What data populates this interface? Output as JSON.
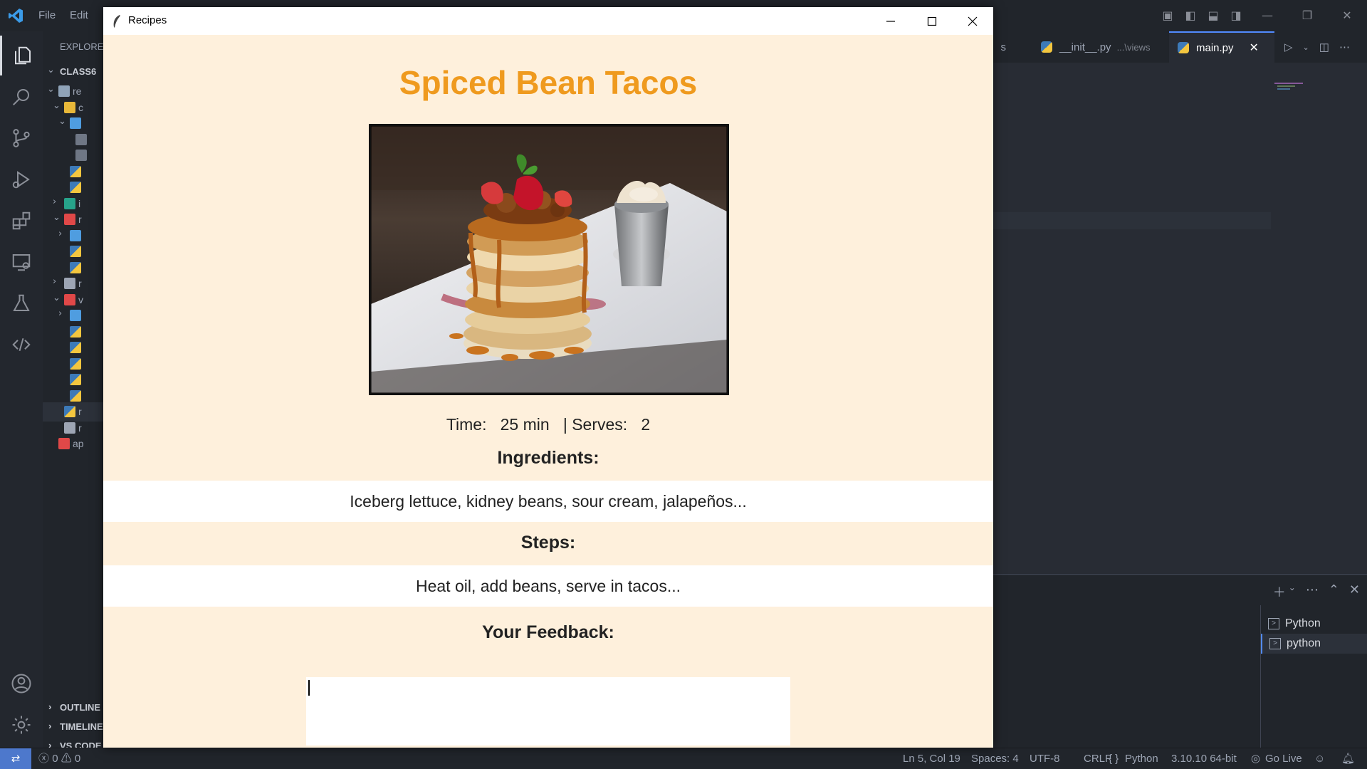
{
  "vscode": {
    "menu": [
      "File",
      "Edit"
    ],
    "sidebar": {
      "title": "EXPLORER",
      "root": "CLASS6",
      "rows": [
        {
          "indent": 1,
          "chevron": "down",
          "icon": "folder-open",
          "label": "re"
        },
        {
          "indent": 2,
          "chevron": "down",
          "icon": "folder-special",
          "label": "c"
        },
        {
          "indent": 3,
          "chevron": "down",
          "icon": "folder-blue",
          "label": ""
        },
        {
          "indent": 4,
          "chevron": "",
          "icon": "file",
          "label": ""
        },
        {
          "indent": 4,
          "chevron": "",
          "icon": "file",
          "label": ""
        },
        {
          "indent": 3,
          "chevron": "",
          "icon": "python-file",
          "label": ""
        },
        {
          "indent": 3,
          "chevron": "",
          "icon": "python-file",
          "label": ""
        },
        {
          "indent": 2,
          "chevron": "right",
          "icon": "folder-teal",
          "label": "i"
        },
        {
          "indent": 2,
          "chevron": "down",
          "icon": "folder-red",
          "label": "r"
        },
        {
          "indent": 3,
          "chevron": "right",
          "icon": "folder-blue",
          "label": ""
        },
        {
          "indent": 3,
          "chevron": "",
          "icon": "python-file",
          "label": ""
        },
        {
          "indent": 3,
          "chevron": "",
          "icon": "python-file",
          "label": ""
        },
        {
          "indent": 2,
          "chevron": "right",
          "icon": "folder-grey",
          "label": "r"
        },
        {
          "indent": 2,
          "chevron": "down",
          "icon": "folder-red",
          "label": "v"
        },
        {
          "indent": 3,
          "chevron": "right",
          "icon": "folder-blue",
          "label": ""
        },
        {
          "indent": 3,
          "chevron": "",
          "icon": "python-file",
          "label": ""
        },
        {
          "indent": 3,
          "chevron": "",
          "icon": "python-file",
          "label": ""
        },
        {
          "indent": 3,
          "chevron": "",
          "icon": "python-file",
          "label": ""
        },
        {
          "indent": 3,
          "chevron": "",
          "icon": "python-file",
          "label": ""
        },
        {
          "indent": 3,
          "chevron": "",
          "icon": "python-file",
          "label": ""
        },
        {
          "indent": 2,
          "chevron": "",
          "icon": "python-file",
          "label": "r",
          "selected": true
        },
        {
          "indent": 2,
          "chevron": "",
          "icon": "text-file",
          "label": "r"
        },
        {
          "indent": 1,
          "chevron": "",
          "icon": "pdf-file",
          "label": "ap"
        }
      ],
      "sections": [
        "OUTLINE",
        "TIMELINE",
        "VS CODE"
      ]
    },
    "tabs": [
      {
        "label": "s",
        "active": false
      },
      {
        "label": "__init__.py",
        "suffix": "...\\views",
        "active": false
      },
      {
        "label": "main.py",
        "active": true
      }
    ],
    "terminals": [
      {
        "label": "Python",
        "selected": false
      },
      {
        "label": "python",
        "selected": true
      }
    ],
    "status": {
      "errors": "0",
      "warnings": "0",
      "position": "Ln 5, Col 19",
      "spaces": "Spaces: 4",
      "encoding": "UTF-8",
      "eol": "CRLF",
      "language": "Python",
      "interpreter": "3.10.10 64-bit",
      "live": "Go Live"
    }
  },
  "recipe_window": {
    "title": "Recipes",
    "recipe_title": "Spiced Bean Tacos",
    "meta_line": "Time:   25 min   | Serves:   2",
    "ingredients_heading": "Ingredients:",
    "ingredients": "Iceberg lettuce, kidney beans, sour cream, jalapeños...",
    "steps_heading": "Steps:",
    "steps": "Heat oil, add beans, serve in tacos...",
    "feedback_heading": "Your Feedback:",
    "feedback_value": "",
    "image_subject": "pancake-stack-photo"
  },
  "colors": {
    "title_orange": "#ef9a1e",
    "window_bg": "#fef0dc",
    "vscode_bg": "#21252b",
    "accent_blue": "#4d78cc"
  }
}
